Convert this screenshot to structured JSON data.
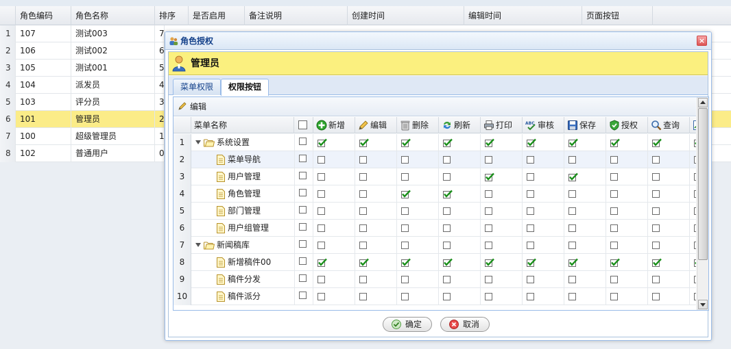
{
  "background_grid": {
    "columns": [
      "角色编码",
      "角色名称",
      "排序",
      "是否启用",
      "备注说明",
      "创建时间",
      "编辑时间",
      "页面按钮"
    ],
    "rows": [
      {
        "rn": "1",
        "code": "107",
        "name": "测试003",
        "sort": "7"
      },
      {
        "rn": "2",
        "code": "106",
        "name": "测试002",
        "sort": "6"
      },
      {
        "rn": "3",
        "code": "105",
        "name": "测试001",
        "sort": "5"
      },
      {
        "rn": "4",
        "code": "104",
        "name": "派发员",
        "sort": "4"
      },
      {
        "rn": "5",
        "code": "103",
        "name": "评分员",
        "sort": "3"
      },
      {
        "rn": "6",
        "code": "101",
        "name": "管理员",
        "sort": "2"
      },
      {
        "rn": "7",
        "code": "100",
        "name": "超级管理员",
        "sort": "1"
      },
      {
        "rn": "8",
        "code": "102",
        "name": "普通用户",
        "sort": "0"
      }
    ],
    "selected_row": 5
  },
  "dialog": {
    "title": "角色授权",
    "close_label": "×",
    "role_name": "管理员",
    "tabs": [
      {
        "label": "菜单权限",
        "active": false
      },
      {
        "label": "权限按钮",
        "active": true
      }
    ],
    "toolbar": {
      "edit_label": "编辑"
    },
    "grid": {
      "name_header": "菜单名称",
      "permission_headers": [
        {
          "label": "新增",
          "icon": "add-icon"
        },
        {
          "label": "编辑",
          "icon": "pencil-icon"
        },
        {
          "label": "删除",
          "icon": "trash-icon"
        },
        {
          "label": "刷新",
          "icon": "refresh-icon"
        },
        {
          "label": "打印",
          "icon": "printer-icon"
        },
        {
          "label": "审核",
          "icon": "spellcheck-icon"
        },
        {
          "label": "保存",
          "icon": "save-icon"
        },
        {
          "label": "授权",
          "icon": "shield-icon"
        },
        {
          "label": "查询",
          "icon": "search-icon"
        },
        {
          "label": "",
          "icon": "chart-icon"
        }
      ],
      "rows": [
        {
          "rn": "1",
          "name": "系统设置",
          "level": 0,
          "folder": true,
          "checks": [
            true,
            true,
            true,
            true,
            true,
            true,
            true,
            true,
            true,
            true
          ]
        },
        {
          "rn": "2",
          "name": "菜单导航",
          "level": 1,
          "folder": false,
          "checks": [
            false,
            false,
            false,
            false,
            false,
            false,
            false,
            false,
            false,
            false
          ]
        },
        {
          "rn": "3",
          "name": "用户管理",
          "level": 1,
          "folder": false,
          "checks": [
            false,
            false,
            false,
            false,
            true,
            false,
            true,
            false,
            false,
            false
          ]
        },
        {
          "rn": "4",
          "name": "角色管理",
          "level": 1,
          "folder": false,
          "checks": [
            false,
            false,
            true,
            true,
            false,
            false,
            false,
            false,
            false,
            false
          ]
        },
        {
          "rn": "5",
          "name": "部门管理",
          "level": 1,
          "folder": false,
          "checks": [
            false,
            false,
            false,
            false,
            false,
            false,
            false,
            false,
            false,
            false
          ]
        },
        {
          "rn": "6",
          "name": "用户组管理",
          "level": 1,
          "folder": false,
          "checks": [
            false,
            false,
            false,
            false,
            false,
            false,
            false,
            false,
            false,
            false
          ]
        },
        {
          "rn": "7",
          "name": "新闻稿库",
          "level": 0,
          "folder": true,
          "checks": [
            false,
            false,
            false,
            false,
            false,
            false,
            false,
            false,
            false,
            false
          ]
        },
        {
          "rn": "8",
          "name": "新增稿件00",
          "level": 1,
          "folder": false,
          "checks": [
            true,
            true,
            true,
            true,
            true,
            true,
            true,
            true,
            true,
            true
          ]
        },
        {
          "rn": "9",
          "name": "稿件分发",
          "level": 1,
          "folder": false,
          "checks": [
            false,
            false,
            false,
            false,
            false,
            false,
            false,
            false,
            false,
            false
          ]
        },
        {
          "rn": "10",
          "name": "稿件派分",
          "level": 1,
          "folder": false,
          "checks": [
            false,
            false,
            false,
            false,
            false,
            false,
            false,
            false,
            false,
            false
          ]
        }
      ],
      "highlighted_row": 1
    },
    "footer": {
      "ok_label": "确定",
      "cancel_label": "取消"
    }
  },
  "colors": {
    "banner": "#fbf07f",
    "selected_row": "#fbec88",
    "check_green": "#1a8f1a",
    "title_text": "#15428b"
  }
}
